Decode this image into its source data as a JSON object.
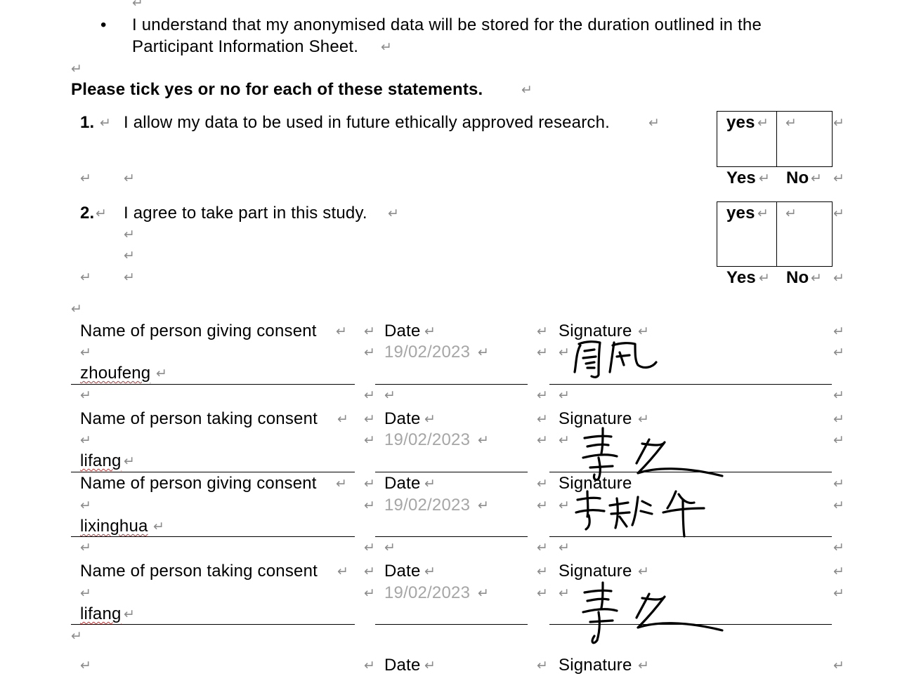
{
  "marks": {
    "paragraph": "↵",
    "cell": "↵"
  },
  "intro": {
    "bullet": "•",
    "line1": "I understand that my anonymised data will be stored for the duration outlined in the",
    "line2": "Participant Information Sheet."
  },
  "instruction": "Please tick yes or no for each of these statements.",
  "statements": [
    {
      "number": "1.",
      "text": "I allow my data to be used in future ethically approved research.",
      "box_yes": "yes",
      "yes_label": "Yes",
      "no_label": "No"
    },
    {
      "number": "2.",
      "text": "I agree to take part in this study.",
      "box_yes": "yes",
      "yes_label": "Yes",
      "no_label": "No"
    }
  ],
  "consent_blocks": [
    {
      "name_label": "Name of person giving consent",
      "name_value": "zhoufeng",
      "date_label": "Date",
      "date_value": "19/02/2023",
      "signature_label": "Signature"
    },
    {
      "name_label": "Name of person taking consent",
      "name_value": "lifang",
      "date_label": "Date",
      "date_value": "19/02/2023",
      "signature_label": "Signature"
    },
    {
      "name_label": "Name of person giving consent",
      "name_value": "lixinghua",
      "date_label": "Date",
      "date_value": "19/02/2023",
      "signature_label": "Signature"
    },
    {
      "name_label": "Name of person taking consent",
      "name_value": "lifang",
      "date_label": "Date",
      "date_value": "19/02/2023",
      "signature_label": "Signature"
    }
  ],
  "partial_row": {
    "date_label": "Date",
    "signature_label": "Signature"
  }
}
